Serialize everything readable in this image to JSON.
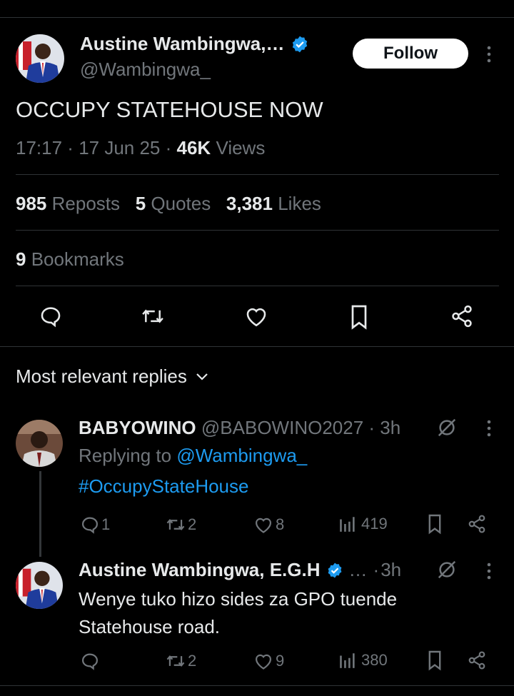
{
  "tweet": {
    "author_name": "Austine Wambingwa,…",
    "handle": "@Wambingwa_",
    "follow_label": "Follow",
    "text": "OCCUPY STATEHOUSE NOW",
    "time": "17:17",
    "date": "17 Jun 25",
    "views_count": "46K",
    "views_label": "Views",
    "reposts_count": "985",
    "reposts_label": "Reposts",
    "quotes_count": "5",
    "quotes_label": "Quotes",
    "likes_count": "3,381",
    "likes_label": "Likes",
    "bookmarks_count": "9",
    "bookmarks_label": "Bookmarks"
  },
  "replies_header": "Most relevant replies",
  "replies": [
    {
      "name": "BABYOWINO",
      "handle": "@BABOWINO2027",
      "time": "3h",
      "replying_prefix": "Replying to",
      "replying_handle": "@Wambingwa_",
      "text": "#OccupyStateHouse",
      "comments": "1",
      "reposts": "2",
      "likes": "8",
      "views": "419"
    },
    {
      "name": "Austine Wambingwa, E.G.H",
      "ellipsis": "…",
      "time": "3h",
      "text_line1": "Wenye tuko hizo sides za GPO tuende",
      "text_line2": "Statehouse road.",
      "reposts": "2",
      "likes": "9",
      "views": "380"
    }
  ],
  "colors": {
    "background": "#000000",
    "accent": "#1d9bf0",
    "text": "#e7e9ea",
    "muted": "#71767b"
  },
  "icons": [
    "verified-badge-icon",
    "more-options-icon",
    "reply-icon",
    "repost-icon",
    "like-icon",
    "bookmark-icon",
    "share-icon",
    "chevron-down-icon",
    "grok-icon",
    "views-icon"
  ]
}
